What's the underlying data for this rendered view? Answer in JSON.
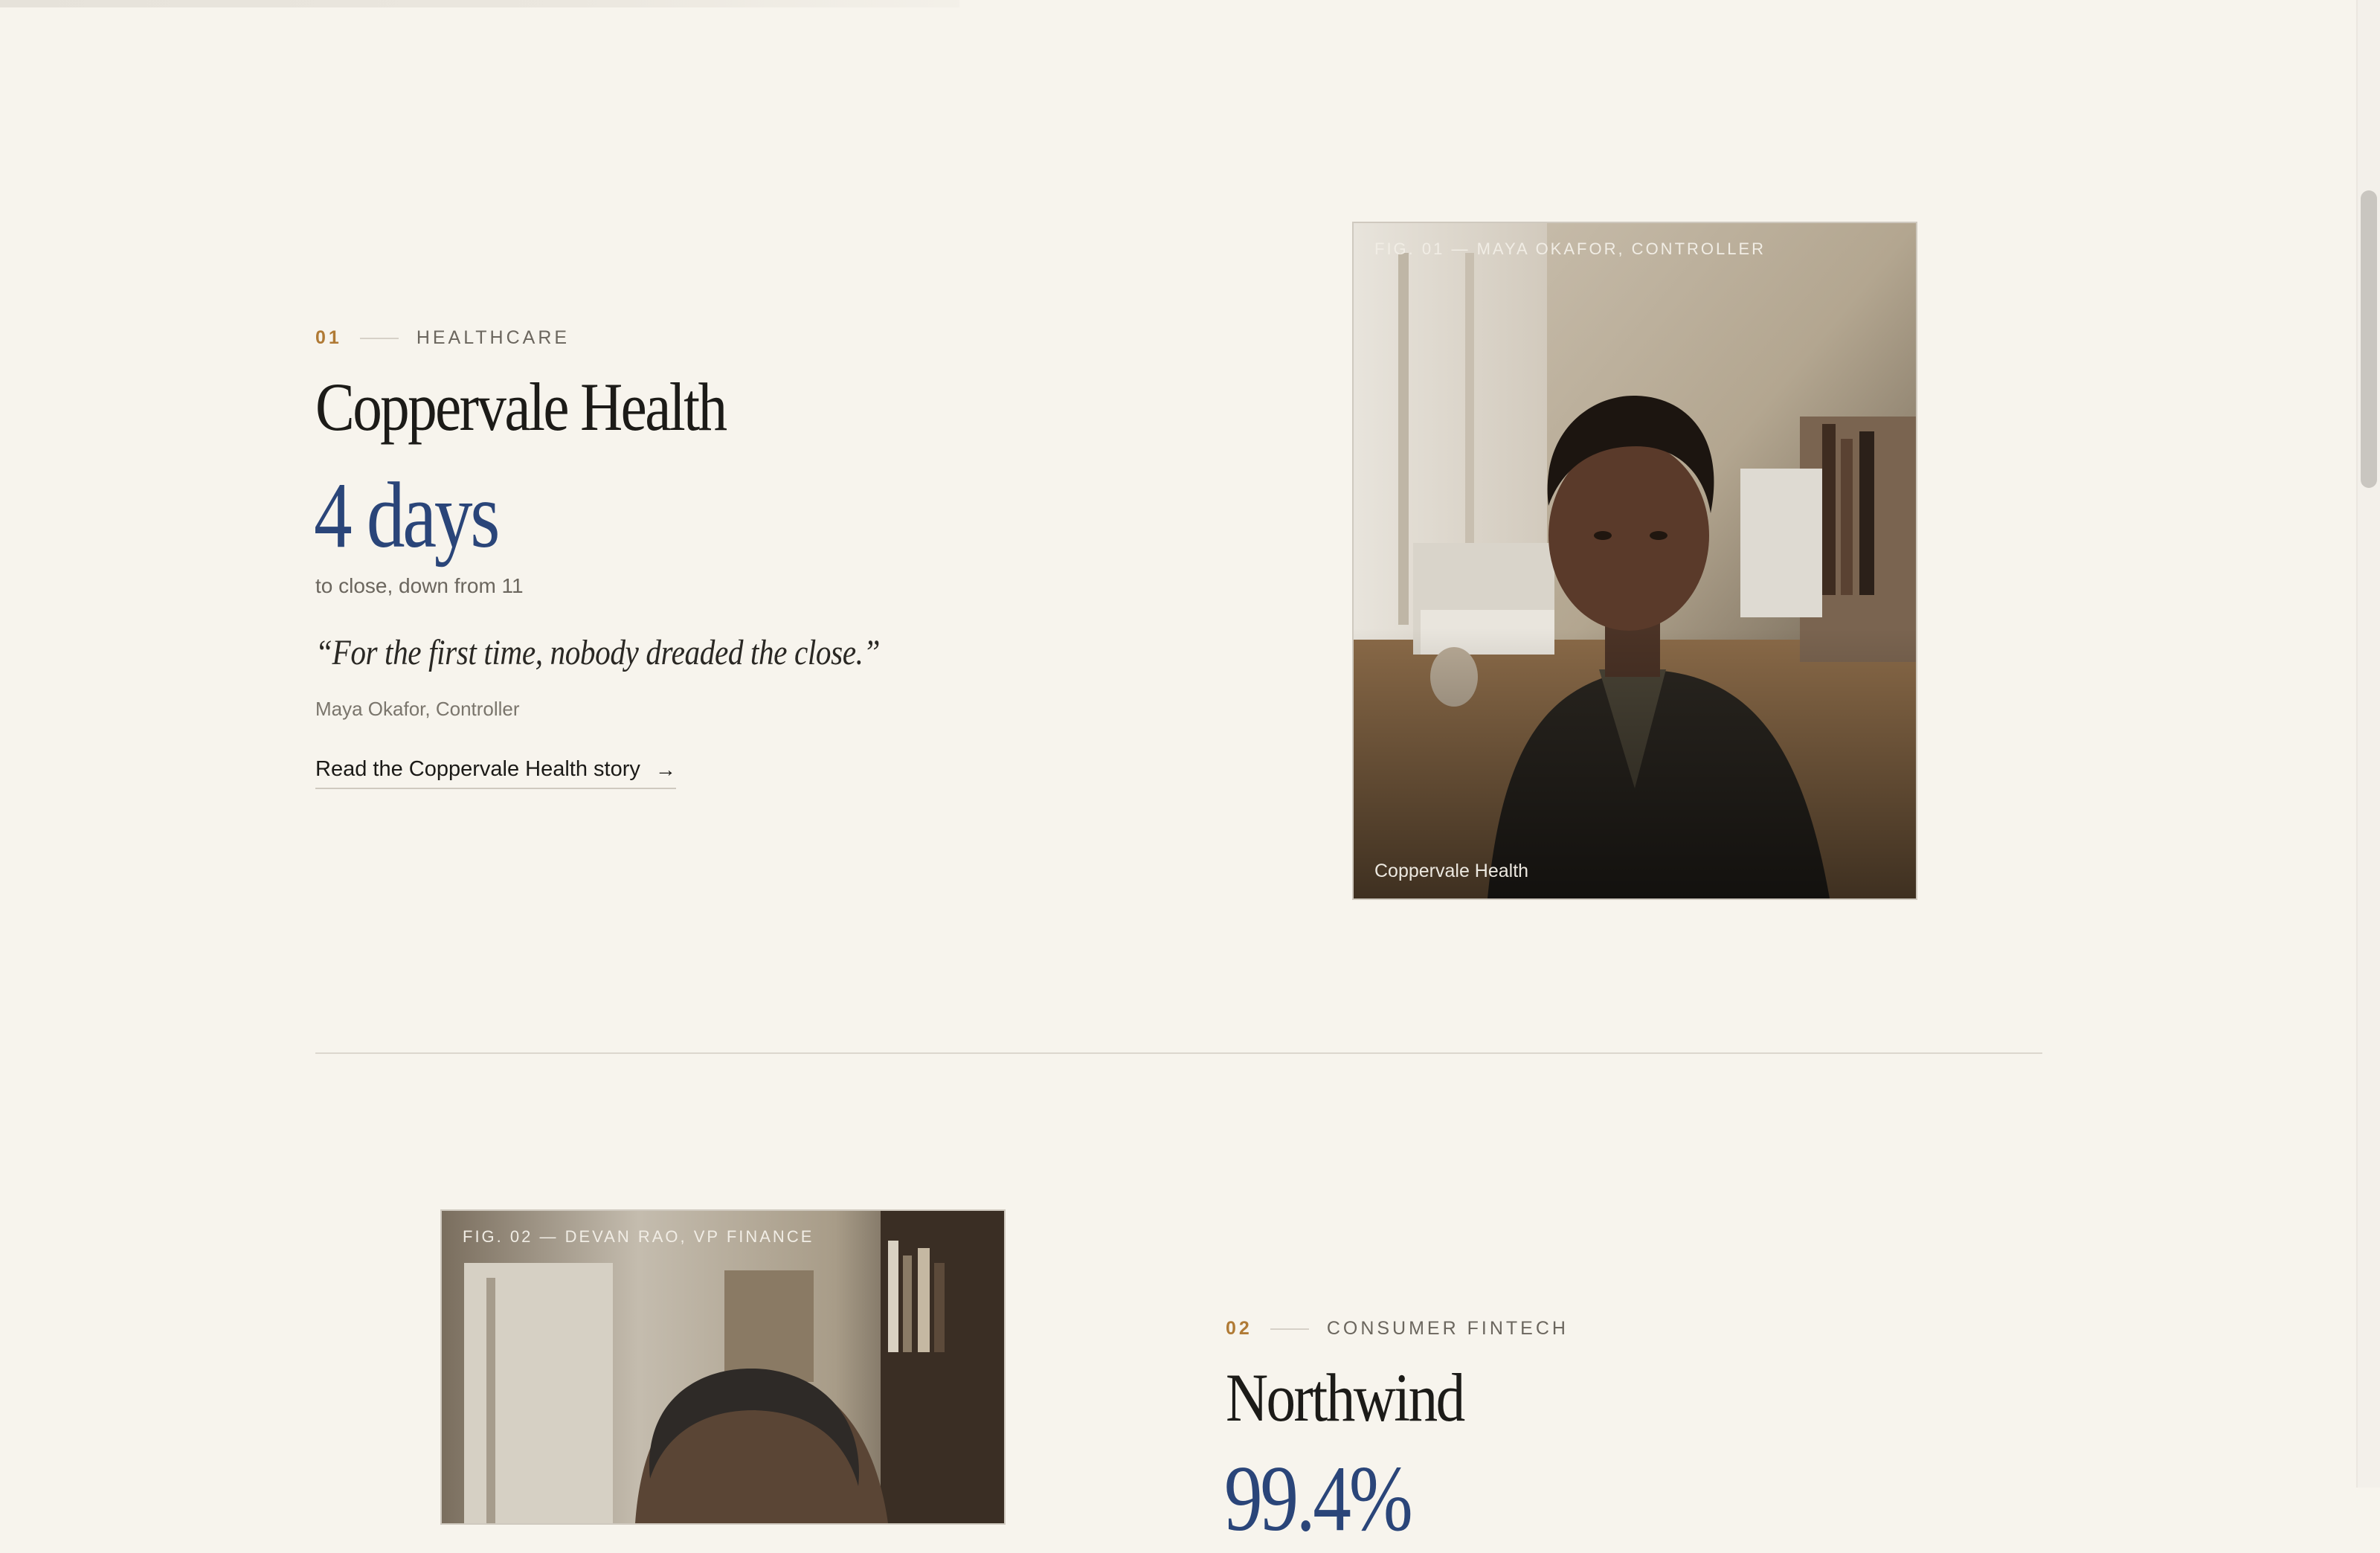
{
  "colors": {
    "background": "#f7f4ed",
    "accent_number": "#b07a35",
    "metric_blue": "#2a4579",
    "text": "#1b1a17"
  },
  "stories": [
    {
      "number": "01",
      "category": "HEALTHCARE",
      "company": "Coppervale Health",
      "metric": "4 days",
      "metric_sub": "to close, down from 11",
      "quote": "“For the first time, nobody dreaded the close.”",
      "attribution": "Maya Okafor, Controller",
      "link_label": "Read the Coppervale Health story",
      "link_icon": "arrow-right-icon",
      "figure_label": "FIG. 01 — MAYA OKAFOR, CONTROLLER",
      "figure_caption": "Coppervale Health"
    },
    {
      "number": "02",
      "category": "CONSUMER FINTECH",
      "company": "Northwind",
      "metric": "99.4%",
      "figure_label": "FIG. 02 — DEVAN RAO, VP FINANCE"
    }
  ]
}
